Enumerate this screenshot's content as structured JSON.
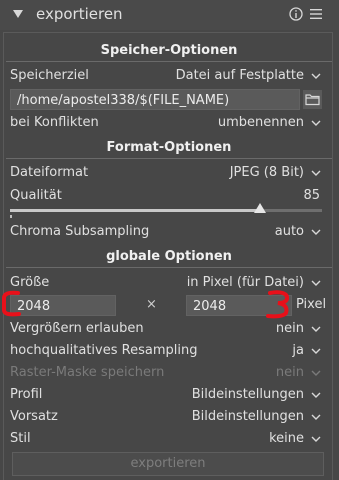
{
  "header": {
    "title": "exportieren",
    "collapse_icon": "collapse-triangle-icon",
    "info_icon": "info-icon",
    "menu_icon": "hamburger-menu-icon"
  },
  "storage": {
    "section": "Speicher-Optionen",
    "target_label": "Speicherziel",
    "target_value": "Datei auf Festplatte",
    "path": "/home/apostel338/$(FILE_NAME)",
    "conflict_label": "bei Konflikten",
    "conflict_value": "umbenennen"
  },
  "format": {
    "section": "Format-Optionen",
    "fileformat_label": "Dateiformat",
    "fileformat_value": "JPEG (8 Bit)",
    "quality_label": "Qualität",
    "quality_value": "85",
    "quality_fraction": 0.8,
    "chroma_label": "Chroma Subsampling",
    "chroma_value": "auto"
  },
  "global": {
    "section": "globale Optionen",
    "size_label": "Größe",
    "size_value": "in Pixel (für Datei)",
    "width": "2048",
    "times": "×",
    "height": "2048",
    "unit": "Pixel",
    "upscale_label": "Vergrößern erlauben",
    "upscale_value": "nein",
    "hq_label": "hochqualitatives Resampling",
    "hq_value": "ja",
    "mask_label": "Raster-Maske speichern",
    "mask_value": "nein",
    "profile_label": "Profil",
    "profile_value": "Bildeinstellungen",
    "intent_label": "Vorsatz",
    "intent_value": "Bildeinstellungen",
    "style_label": "Stil",
    "style_value": "keine"
  },
  "export_button": "exportieren",
  "colors": {
    "background": "#474747",
    "entry": "#5a5a5a",
    "annotation": "#e8101a"
  }
}
